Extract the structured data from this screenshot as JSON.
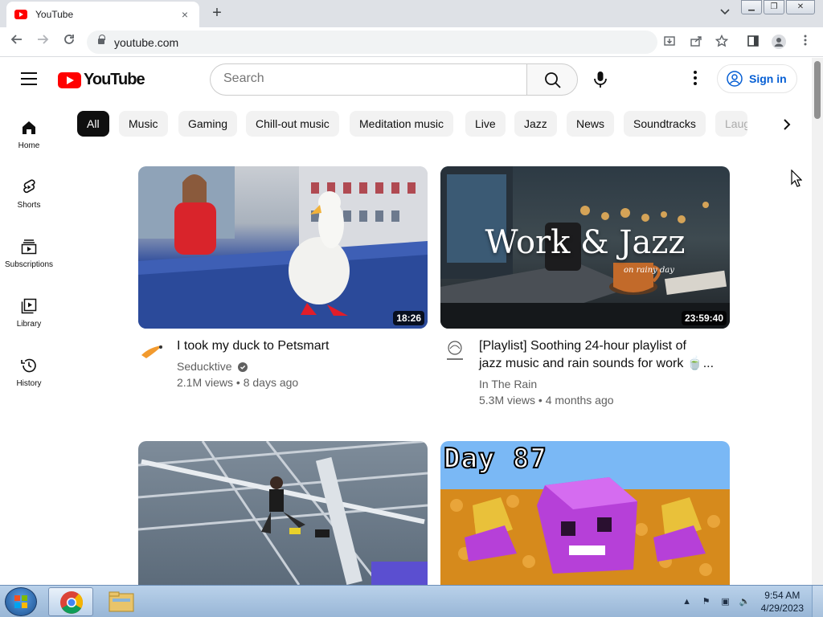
{
  "browser": {
    "tab_title": "YouTube",
    "tab_close": "×",
    "new_tab": "+",
    "url": "youtube.com"
  },
  "header": {
    "logo_text": "YouTube",
    "search_placeholder": "Search",
    "signin_label": "Sign in"
  },
  "chips": [
    "All",
    "Music",
    "Gaming",
    "Chill-out music",
    "Meditation music",
    "Live",
    "Jazz",
    "News",
    "Soundtracks",
    "Laugh"
  ],
  "sidebar": [
    {
      "label": "Home",
      "icon": "home-icon"
    },
    {
      "label": "Shorts",
      "icon": "shorts-icon"
    },
    {
      "label": "Subscriptions",
      "icon": "subscriptions-icon"
    },
    {
      "label": "Library",
      "icon": "library-icon"
    },
    {
      "label": "History",
      "icon": "history-icon"
    }
  ],
  "videos": [
    {
      "title": "I took my duck to Petsmart",
      "channel": "Seducktive",
      "verified": true,
      "meta": "2.1M views • 8 days ago",
      "duration": "18:26",
      "thumb_color": "#3b5fb0"
    },
    {
      "title_line1": "[Playlist] Soothing 24-hour playlist of",
      "title_line2": "jazz music and rain sounds for work 🍵...",
      "channel": "In The Rain",
      "meta": "5.3M views • 4 months ago",
      "duration": "23:59:40",
      "thumb_text": "Work & Jazz",
      "thumb_subtext": "on rainy day"
    },
    {
      "title": "",
      "thumb_color": "#6b7b8c"
    },
    {
      "title": "",
      "thumb_text": "Day 87",
      "thumb_color": "#7ab8f5"
    }
  ],
  "taskbar": {
    "time": "9:54 AM",
    "date": "4/29/2023"
  },
  "colors": {
    "yt_red": "#ff0000",
    "link_blue": "#065fd4",
    "chip_bg": "#f2f2f2"
  }
}
